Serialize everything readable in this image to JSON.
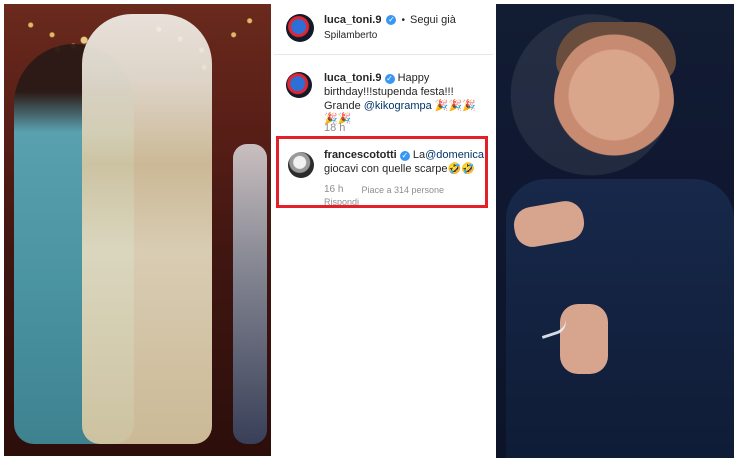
{
  "post": {
    "author_username": "luca_toni.9",
    "follow_text": "Segui già",
    "location": "Spilamberto",
    "caption_username": "luca_toni.9",
    "caption_text": "Happy birthday!!!stupenda festa!!! Grande",
    "caption_mention": "@kikogrampa",
    "caption_emojis": "🎉🎉🎉🎉🎉",
    "caption_time": "18 h"
  },
  "comment": {
    "username": "francescototti",
    "text_prefix": "La",
    "mention": "@domenica",
    "text_suffix": "giocavi con quelle scarpe",
    "emojis": "🤣🤣",
    "time": "16 h",
    "likes": "Piace a 314 persone",
    "reply": "Rispondi"
  },
  "colors": {
    "highlight_border": "#e3202a",
    "verified_badge": "#3897f0",
    "mention": "#003569",
    "meta_text": "#8e8e8e"
  },
  "icons": {
    "verified": "check-badge-icon"
  }
}
